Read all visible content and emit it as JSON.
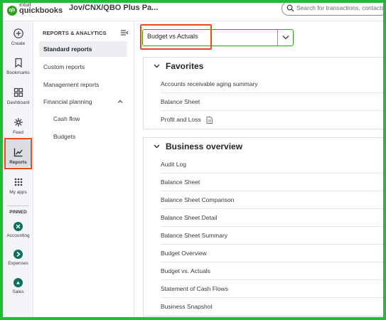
{
  "topbar": {
    "logo_mark": "qb",
    "logo_brand": "intuit",
    "logo_product": "quickbooks",
    "company": "Jov/CNX/QBO Plus Pa...",
    "search_placeholder": "Search for transactions, contacts, re"
  },
  "rail": {
    "items": [
      {
        "label": "Create",
        "icon": "plus-circle-icon"
      },
      {
        "label": "Bookmarks",
        "icon": "bookmark-icon"
      },
      {
        "label": "Dashboard",
        "icon": "dashboard-icon"
      },
      {
        "label": "Feed",
        "icon": "feed-icon"
      },
      {
        "label": "Reports",
        "icon": "chart-line-icon"
      },
      {
        "label": "My apps",
        "icon": "grid-icon"
      }
    ],
    "pinned_label": "PINNED",
    "pinned": [
      {
        "label": "Accounting",
        "icon": "accounting-app-icon"
      },
      {
        "label": "Expenses",
        "icon": "expenses-app-icon"
      },
      {
        "label": "Sales",
        "icon": "sales-app-icon"
      }
    ],
    "colors": {
      "app_dot": "#0d6f5e",
      "highlight": "#e84d1c"
    }
  },
  "subnav": {
    "title": "REPORTS & ANALYTICS",
    "items": [
      {
        "label": "Standard reports",
        "active": true
      },
      {
        "label": "Custom reports"
      },
      {
        "label": "Management reports"
      },
      {
        "label": "Financial planning",
        "expanded": true
      },
      {
        "label": "Cash flow",
        "child": true
      },
      {
        "label": "Budgets",
        "child": true
      }
    ]
  },
  "main": {
    "search_value": "Budget vs Actuals",
    "sections": [
      {
        "title": "Favorites",
        "rows": [
          "Accounts receivable aging summary",
          "Balance Sheet",
          "Profit and Loss"
        ]
      },
      {
        "title": "Business overview",
        "rows": [
          "Audit Log",
          "Balance Sheet",
          "Balance Sheet Comparison",
          "Balance Sheet Detail",
          "Balance Sheet Summary",
          "Budget Overview",
          "Budget vs. Actuals",
          "Statement of Cash Flows",
          "Business Snapshot"
        ]
      }
    ]
  },
  "colors": {
    "brand_green": "#2ca01c",
    "frame_green": "#1fbd35"
  }
}
